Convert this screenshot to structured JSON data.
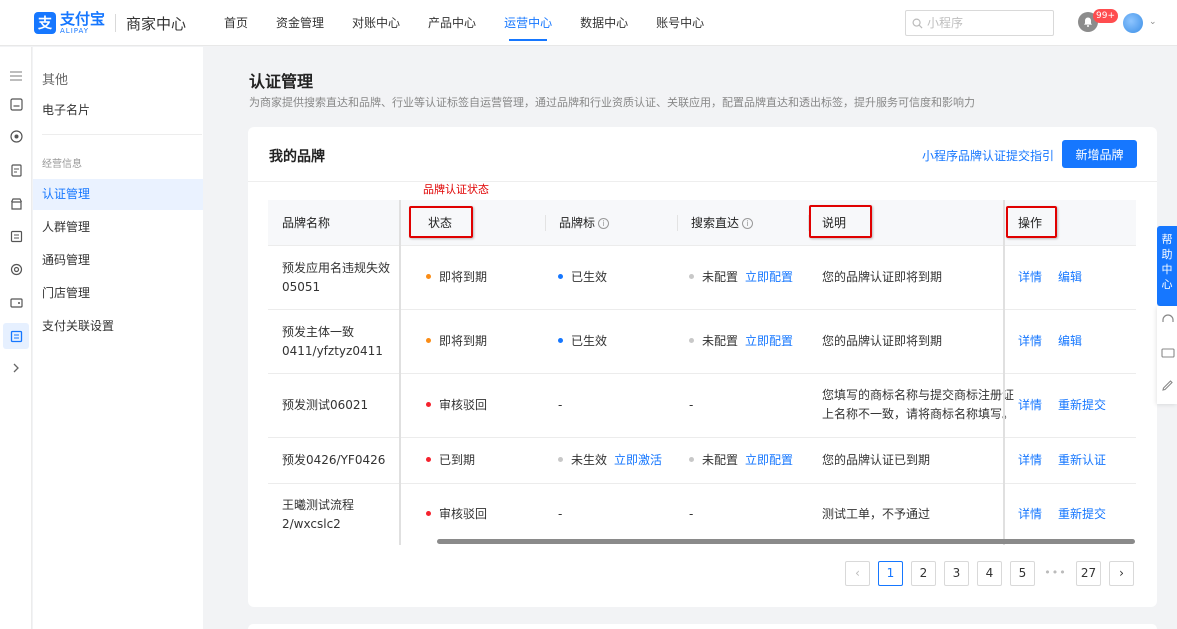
{
  "brand": {
    "logo_cn": "支付宝",
    "logo_en": "ALIPAY",
    "subtitle": "商家中心",
    "color": "#1677ff"
  },
  "nav": {
    "items": [
      {
        "label": "首页",
        "active": false
      },
      {
        "label": "资金管理",
        "active": false
      },
      {
        "label": "对账中心",
        "active": false
      },
      {
        "label": "产品中心",
        "active": false
      },
      {
        "label": "运营中心",
        "active": true
      },
      {
        "label": "数据中心",
        "active": false
      },
      {
        "label": "账号中心",
        "active": false
      }
    ],
    "search_placeholder": "小程序",
    "badge": "99+"
  },
  "sidebar": {
    "section_title": "其他",
    "top_item": "电子名片",
    "group_label": "经营信息",
    "items": [
      {
        "label": "认证管理",
        "active": true
      },
      {
        "label": "人群管理",
        "active": false
      },
      {
        "label": "通码管理",
        "active": false
      },
      {
        "label": "门店管理",
        "active": false
      },
      {
        "label": "支付关联设置",
        "active": false
      }
    ]
  },
  "page": {
    "title": "认证管理",
    "description": "为商家提供搜索直达和品牌、行业等认证标签自运营管理，通过品牌和行业资质认证、关联应用，配置品牌直达和透出标签，提升服务可信度和影响力"
  },
  "card": {
    "title": "我的品牌",
    "guide_link": "小程序品牌认证提交指引",
    "add_button": "新增品牌",
    "annotation": "品牌认证状态"
  },
  "table": {
    "headers": {
      "name": "品牌名称",
      "status": "状态",
      "mark": "品牌标",
      "search": "搜索直达",
      "note": "说明",
      "ops": "操作"
    },
    "rows": [
      {
        "name_line1": "预发应用名违规失效",
        "name_line2": "05051",
        "status": "即将到期",
        "status_color": "#fa8c16",
        "mark": "已生效",
        "mark_color": "#1677ff",
        "mark_link": "",
        "search": "未配置",
        "search_color": "#c8c8c8",
        "search_link": "立即配置",
        "note_line1": "您的品牌认证即将到期",
        "note_line2": "",
        "op1": "详情",
        "op2": "编辑"
      },
      {
        "name_line1": "预发主体一致",
        "name_line2": "0411/yfztyz0411",
        "status": "即将到期",
        "status_color": "#fa8c16",
        "mark": "已生效",
        "mark_color": "#1677ff",
        "mark_link": "",
        "search": "未配置",
        "search_color": "#c8c8c8",
        "search_link": "立即配置",
        "note_line1": "您的品牌认证即将到期",
        "note_line2": "",
        "op1": "详情",
        "op2": "编辑"
      },
      {
        "name_line1": "预发测试06021",
        "name_line2": "",
        "status": "审核驳回",
        "status_color": "#f5222d",
        "mark": "-",
        "mark_color": "",
        "mark_link": "",
        "search": "-",
        "search_color": "",
        "search_link": "",
        "note_line1": "您填写的商标名称与提交商标注册证",
        "note_line2": "上名称不一致，请将商标名称填写。",
        "op1": "详情",
        "op2": "重新提交"
      },
      {
        "name_line1": "预发0426/YF0426",
        "name_line2": "",
        "status": "已到期",
        "status_color": "#f5222d",
        "mark": "未生效",
        "mark_color": "#c8c8c8",
        "mark_link": "立即激活",
        "search": "未配置",
        "search_color": "#c8c8c8",
        "search_link": "立即配置",
        "note_line1": "您的品牌认证已到期",
        "note_line2": "",
        "op1": "详情",
        "op2": "重新认证"
      },
      {
        "name_line1": "王曦测试流程",
        "name_line2": "2/wxcslc2",
        "status": "审核驳回",
        "status_color": "#f5222d",
        "mark": "-",
        "mark_color": "",
        "mark_link": "",
        "search": "-",
        "search_color": "",
        "search_link": "",
        "note_line1": "测试工单，不予通过",
        "note_line2": "",
        "op1": "详情",
        "op2": "重新提交"
      }
    ]
  },
  "pagination": {
    "pages": [
      "1",
      "2",
      "3",
      "4",
      "5"
    ],
    "current": "1",
    "ellipsis": "•••",
    "last": "27"
  },
  "help": {
    "label": "帮助中心"
  }
}
